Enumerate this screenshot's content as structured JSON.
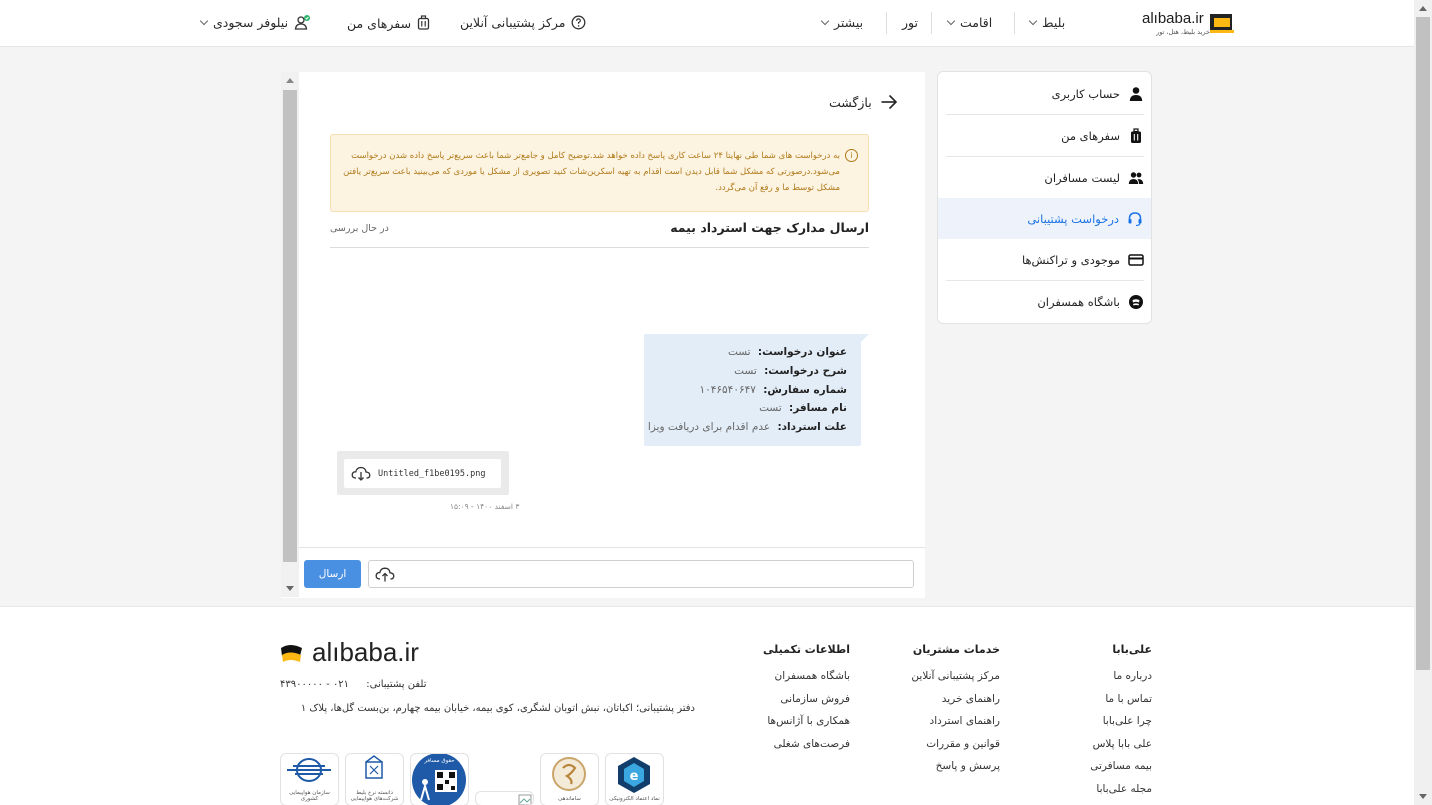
{
  "header": {
    "logo_text": "alıbaba.ir",
    "logo_sub": "خرید بلیط، هتل، تور",
    "nav": {
      "ticket": "بلیط",
      "stay": "اقامت",
      "tour": "تور",
      "more": "بیشتر",
      "support": "مرکز پشتیبانی آنلاین",
      "trips": "سفرهای من",
      "user": "نیلوفر سجودی"
    }
  },
  "sidebar": {
    "items": [
      {
        "label": "حساب کاربری",
        "icon": "user-icon"
      },
      {
        "label": "سفرهای من",
        "icon": "luggage-icon"
      },
      {
        "label": "لیست مسافران",
        "icon": "users-icon"
      },
      {
        "label": "درخواست پشتیبانی",
        "icon": "headset-icon"
      },
      {
        "label": "موجودی و تراکنش‌ها",
        "icon": "card-icon"
      },
      {
        "label": "باشگاه همسفران",
        "icon": "club-icon"
      }
    ]
  },
  "ticket": {
    "back_label": "بازگشت",
    "notice": "به درخواست های شما طی نهایتا ۲۴ ساعت کاری پاسخ داده خواهد شد.توضیح کامل و جامع‌تر شما باعث سریع‌تر پاسخ داده شدن درخواست می‌شود.درصورتی که مشکل شما قابل دیدن است اقدام به تهیه اسکرین‌شات کنید تصویری از مشکل یا موردی که می‌بینید باعث سریع‌تر یافتن مشکل توسط ما و رفع آن می‌گردد.",
    "title": "ارسال مدارک جهت استرداد بیمه",
    "status": "در حال بررسی",
    "message": {
      "rows": [
        {
          "label": "عنوان درخواست:",
          "value": "تست"
        },
        {
          "label": "شرح درخواست:",
          "value": "تست"
        },
        {
          "label": "شماره سفارش:",
          "value": "۱۰۴۶۵۴۰۶۴۷"
        },
        {
          "label": "نام مسافر:",
          "value": "تست"
        },
        {
          "label": "علت استرداد:",
          "value": "عدم اقدام برای دریافت ویزا"
        }
      ]
    },
    "attachment": {
      "file_name": "Untitled_f1be0195.png",
      "time": "۳ اسفند ۱۴۰۰ - ۱۵:۰۹"
    },
    "compose": {
      "send_label": "ارسال",
      "input_value": "",
      "input_placeholder": ""
    }
  },
  "footer": {
    "col_alibaba": {
      "title": "علی‌بابا",
      "links": [
        "درباره ما",
        "تماس با ما",
        "چرا علی‌بابا",
        "علی بابا پلاس",
        "بیمه مسافرتی",
        "مجله علی‌بابا"
      ]
    },
    "col_services": {
      "title": "خدمات مشتریان",
      "links": [
        "مرکز پشتیبانی آنلاین",
        "راهنمای خرید",
        "راهنمای استرداد",
        "قوانین و مقررات",
        "پرسش و پاسخ"
      ]
    },
    "col_info": {
      "title": "اطلاعات تکمیلی",
      "links": [
        "باشگاه همسفران",
        "فروش سازمانی",
        "همکاری با آژانس‌ها",
        "فرصت‌های شغلی"
      ]
    },
    "logo_text": "alıbaba.ir",
    "phone_label": "تلفن پشتیبانی:",
    "phone_value": "۰۲۱ - ۴۳۹۰۰۰۰۰",
    "address": "دفتر پشتیبانی؛ اکباتان، نبش اتوبان لشگری، کوی بیمه، خیابان بیمه چهارم، بن‌بست گل‌ها، پلاک ۱",
    "badges": [
      {
        "caption": "سازمان هواپیمایی کشوری",
        "icon": "civil-aviation-badge"
      },
      {
        "caption": "دانسته نرخ بلیط شرکت‌های هواپیمایی",
        "icon": "ticket-rate-badge"
      },
      {
        "caption": "حقوق مسافر",
        "icon": "passenger-rights-badge"
      },
      {
        "caption": "",
        "icon": "broken-image-badge"
      },
      {
        "caption": "ساماندهی",
        "icon": "samandehi-badge"
      },
      {
        "caption": "نماد اعتماد الکترونیکی",
        "icon": "enamad-badge"
      }
    ]
  },
  "colors": {
    "accent": "#1a73e8",
    "button": "#4a90e2",
    "notice_bg": "#fdf3e1",
    "notice_text": "#b07a1a",
    "bubble_bg": "#e3edf8",
    "brand_yellow": "#fdb813"
  }
}
